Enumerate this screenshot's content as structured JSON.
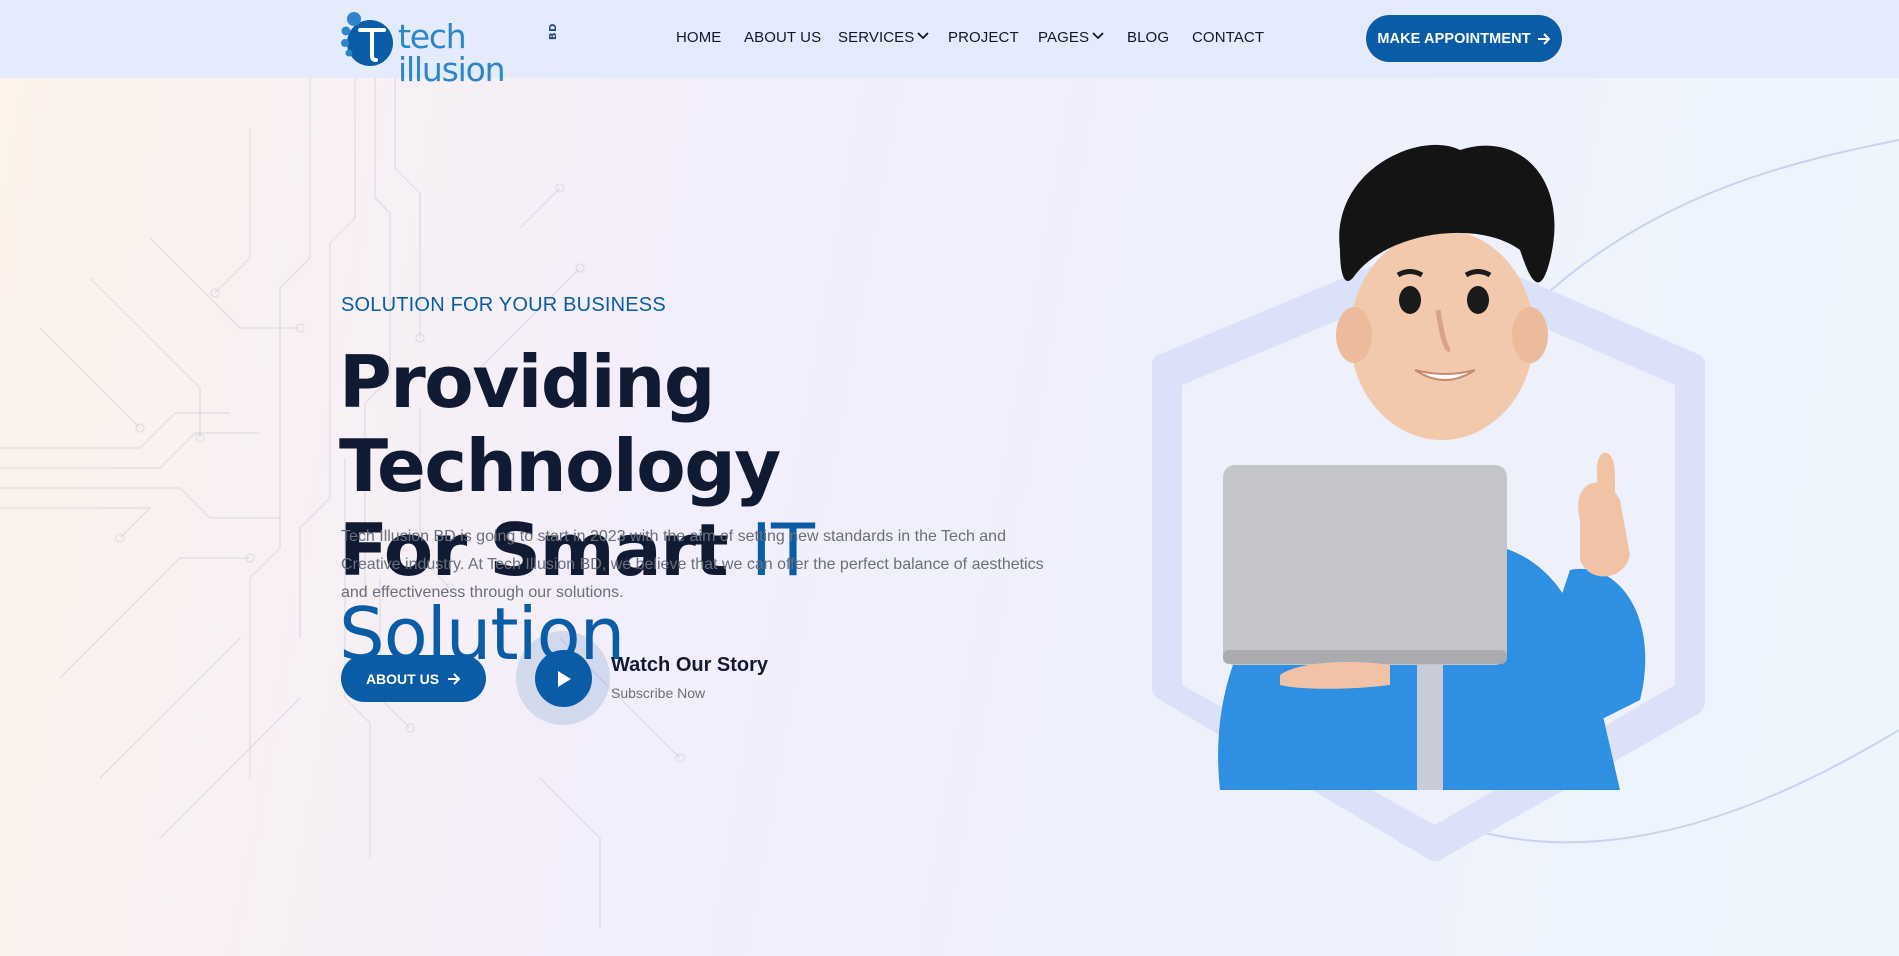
{
  "header": {
    "logo_text": "tech illusion",
    "logo_sub": "BD",
    "nav": [
      {
        "label": "HOME"
      },
      {
        "label": "ABOUT US"
      },
      {
        "label": "SERVICES"
      },
      {
        "label": "PROJECT"
      },
      {
        "label": "PAGES"
      },
      {
        "label": "BLOG"
      },
      {
        "label": "CONTACT"
      }
    ],
    "cta_label": "MAKE APPOINTMENT"
  },
  "hero": {
    "eyebrow": "SOLUTION FOR YOUR BUSINESS",
    "headline_line1": "Providing Technology",
    "headline_line2_plain": "For Smart",
    "headline_line2_accent": "IT Solution",
    "description": "Tech Illusion BD is going to start in 2023 with the aim of setting new standards in the Tech and Creative industry. At Tech Illusion BD, we believe that we can offer the perfect balance of aesthetics and effectiveness through our solutions.",
    "about_button": "ABOUT US",
    "watch_title": "Watch Our Story",
    "watch_subtitle": "Subscribe Now"
  },
  "icons": {
    "nav_dropdown": "chevron-down-icon",
    "button_arrow": "arrow-right-icon",
    "video": "play-icon"
  },
  "colors": {
    "brand": "#0a5ca6",
    "heading": "#111a33",
    "header_bg": "#e3ebfc",
    "body_text": "#6a6f7c"
  }
}
